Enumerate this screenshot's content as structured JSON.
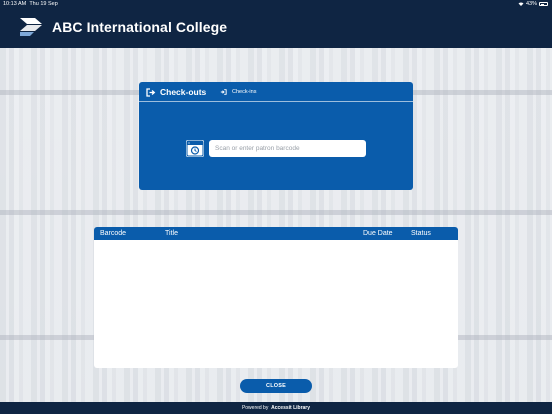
{
  "status_bar": {
    "time": "10:13 AM",
    "date": "Thu 19 Sep",
    "battery": "43%"
  },
  "app": {
    "title": "ABC International College",
    "icon": "college-logo-icon"
  },
  "checkout_panel": {
    "active_tab": "Check-outs",
    "inactive_tab": "Check-ins",
    "barcode_input": {
      "value": "",
      "placeholder": "Scan or enter patron barcode"
    }
  },
  "loans_table": {
    "columns": [
      "Barcode",
      "Title",
      "Due Date",
      "Status"
    ],
    "rows": []
  },
  "close_button": "CLOSE",
  "footer": {
    "prefix": "Powered by",
    "brand": "Accessit Library"
  },
  "colors": {
    "navy": "#0f2543",
    "primary_blue": "#0a5cab",
    "background": "#e9ecf0"
  }
}
